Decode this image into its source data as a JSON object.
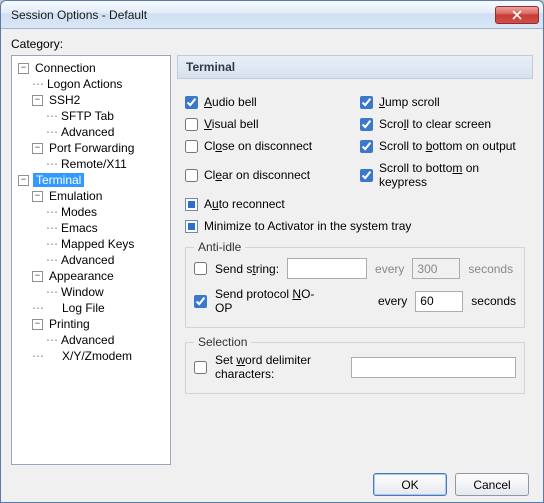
{
  "window": {
    "title": "Session Options - Default"
  },
  "category_label": "Category:",
  "tree": {
    "connection": "Connection",
    "logon_actions": "Logon Actions",
    "ssh2": "SSH2",
    "sftp_tab": "SFTP Tab",
    "ssh_advanced": "Advanced",
    "port_forwarding": "Port Forwarding",
    "remote_x11": "Remote/X11",
    "terminal": "Terminal",
    "emulation": "Emulation",
    "modes": "Modes",
    "emacs": "Emacs",
    "mapped_keys": "Mapped Keys",
    "emu_advanced": "Advanced",
    "appearance": "Appearance",
    "appearance_window": "Window",
    "log_file": "Log File",
    "printing": "Printing",
    "printing_advanced": "Advanced",
    "xyzmodem": "X/Y/Zmodem"
  },
  "panel": {
    "title": "Terminal",
    "audio_bell": "Audio bell",
    "visual_bell": "Visual bell",
    "close_on_disconnect": "Close on disconnect",
    "clear_on_disconnect": "Clear on disconnect",
    "auto_reconnect": "Auto reconnect",
    "minimize_tray": "Minimize to Activator in the system tray",
    "jump_scroll": "Jump scroll",
    "scroll_clear": "Scroll to clear screen",
    "scroll_output": "Scroll to bottom on output",
    "scroll_keypress": "Scroll to bottom on keypress"
  },
  "anti_idle": {
    "legend": "Anti-idle",
    "send_string": "Send string:",
    "send_string_value": "",
    "every": "every",
    "string_interval": "300",
    "seconds": "seconds",
    "send_noop": "Send protocol NO-OP",
    "noop_interval": "60"
  },
  "selection": {
    "legend": "Selection",
    "word_delim": "Set word delimiter characters:",
    "word_delim_value": ""
  },
  "buttons": {
    "ok": "OK",
    "cancel": "Cancel"
  }
}
